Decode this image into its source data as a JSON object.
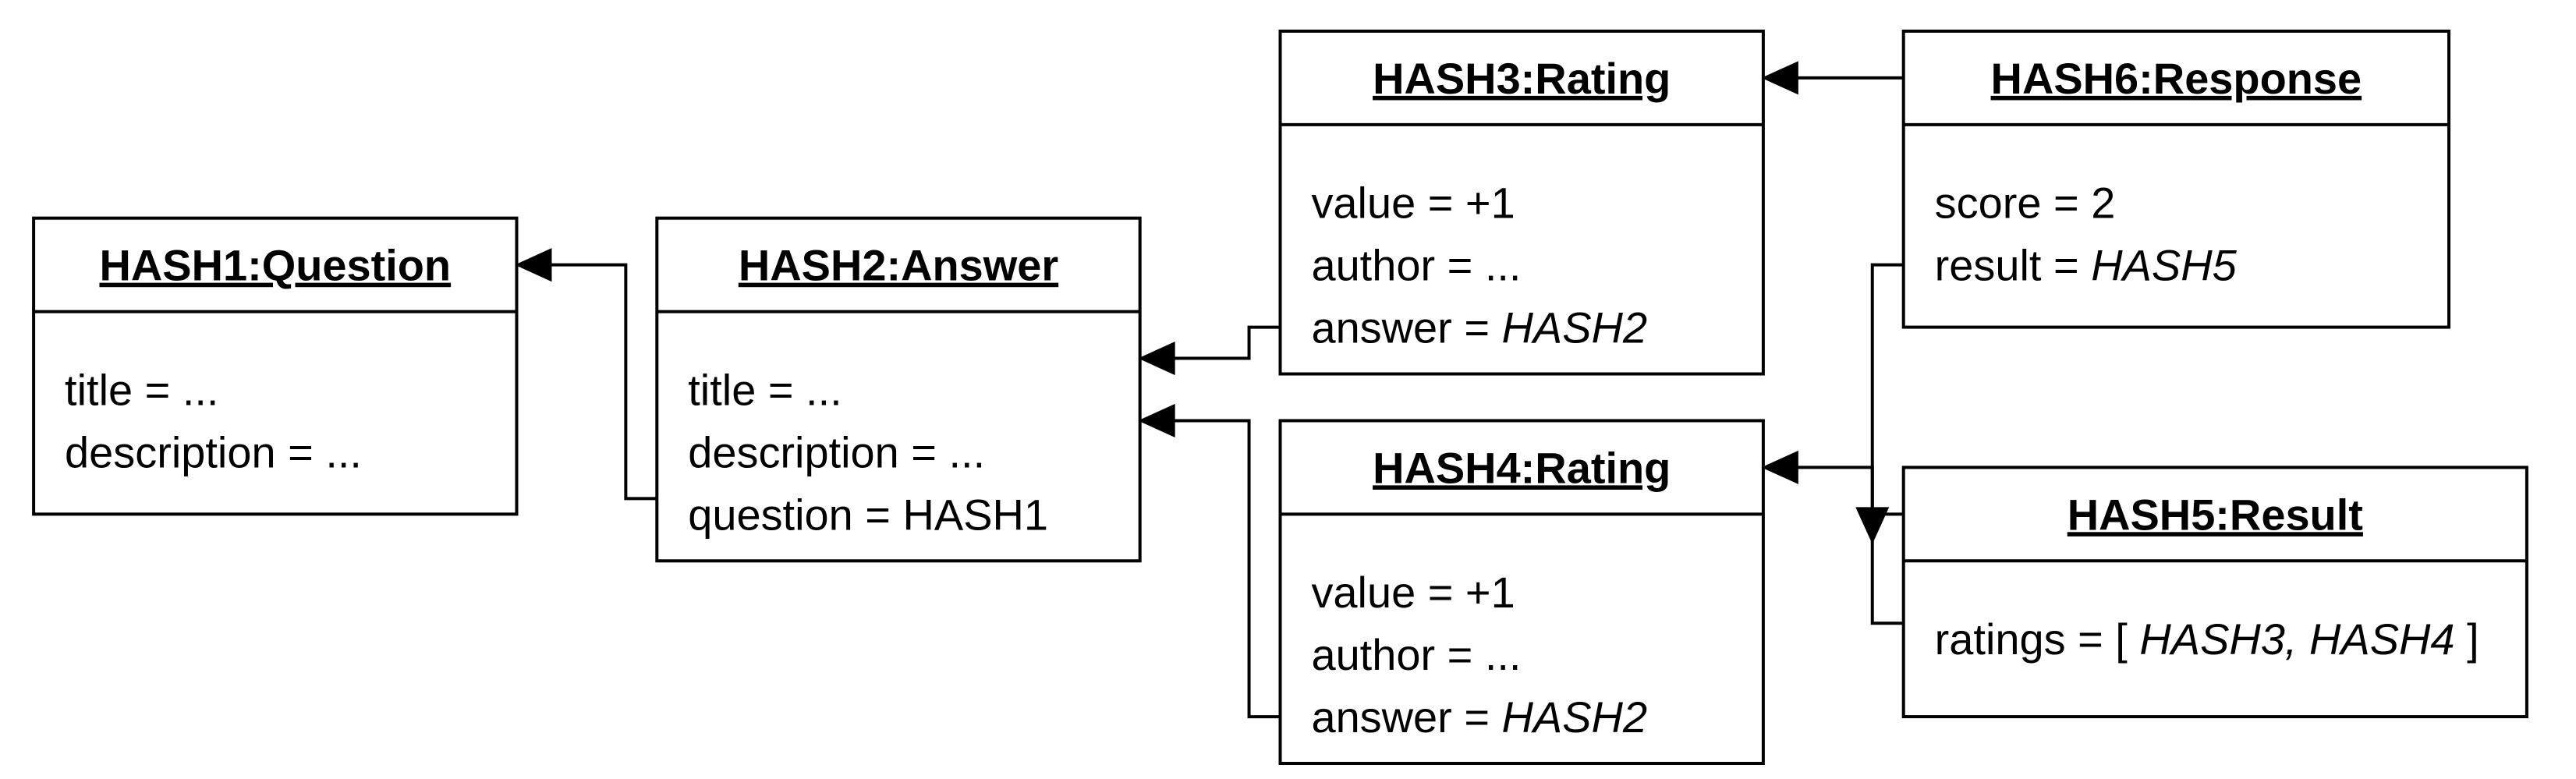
{
  "objects": {
    "question": {
      "title": "HASH1:Question",
      "attrs": [
        "title = ...",
        "description = ..."
      ]
    },
    "answer": {
      "title": "HASH2:Answer",
      "attrs": [
        "title = ...",
        "description = ...",
        "question = HASH1"
      ]
    },
    "rating1": {
      "title": "HASH3:Rating",
      "attrs": [
        "value = +1",
        "author = ...",
        "answer = HASH2"
      ]
    },
    "rating2": {
      "title": "HASH4:Rating",
      "attrs": [
        "value = +1",
        "author = ...",
        "answer = HASH2"
      ]
    },
    "response": {
      "title": "HASH6:Response",
      "attrs": [
        "score = 2",
        "result = HASH5"
      ]
    },
    "result": {
      "title": "HASH5:Result",
      "attrs": [
        "ratings = [ HASH3, HASH4 ]"
      ]
    }
  }
}
